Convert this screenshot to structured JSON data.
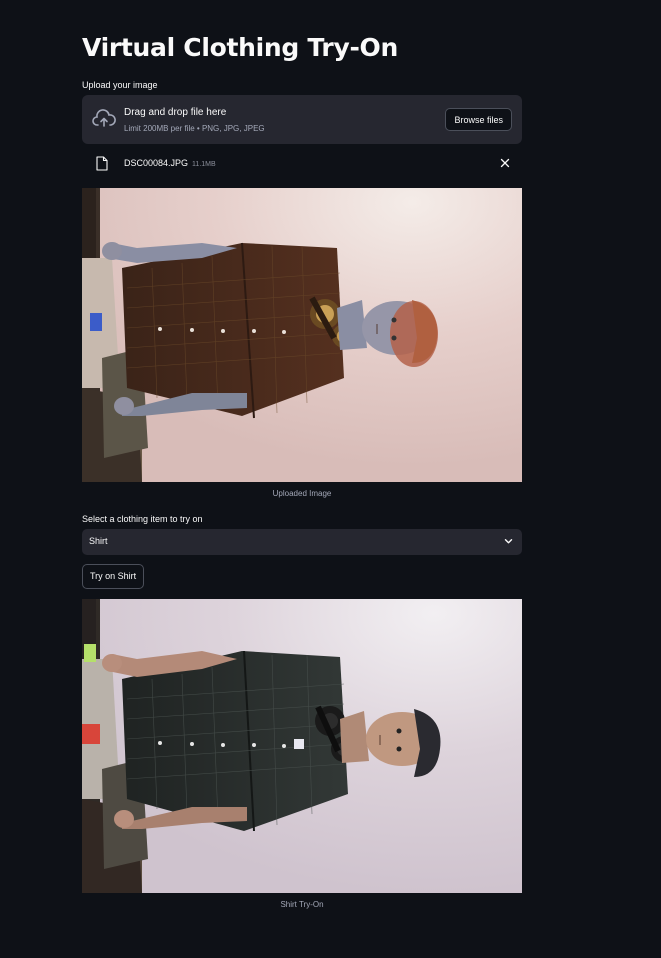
{
  "page": {
    "title": "Virtual Clothing Try-On"
  },
  "uploader": {
    "label": "Upload your image",
    "drop_title": "Drag and drop file here",
    "drop_subtitle": "Limit 200MB per file • PNG, JPG, JPEG",
    "browse_label": "Browse files",
    "file_name": "DSC00084.JPG",
    "file_size": "11.1MB"
  },
  "uploaded_image": {
    "caption": "Uploaded Image"
  },
  "clothing_select": {
    "label": "Select a clothing item to try on",
    "value": "Shirt"
  },
  "try_button": {
    "label": "Try on Shirt"
  },
  "result_image": {
    "caption": "Shirt Try-On"
  },
  "colors": {
    "background": "#0e1117",
    "widget_bg": "#262730",
    "text": "#fafafa",
    "muted_text": "#a3a8b8"
  }
}
